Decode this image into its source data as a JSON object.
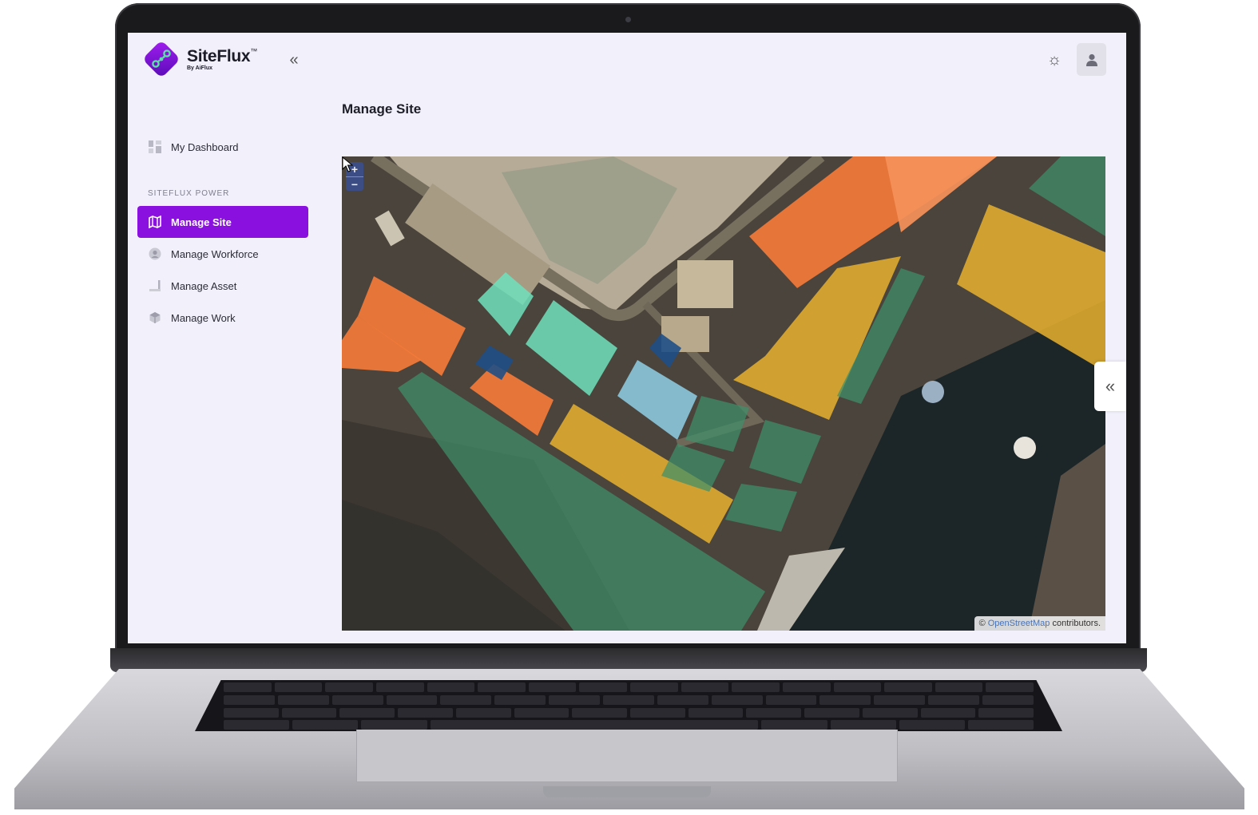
{
  "brand": {
    "name": "SiteFlux",
    "tm": "™",
    "sub": "By AiFlux"
  },
  "sidebar": {
    "collapse_icon": "double-chevron-left-icon",
    "dashboard_label": "My Dashboard",
    "section_label": "SITEFLUX POWER",
    "items": [
      {
        "label": "Manage Site",
        "icon": "map-icon",
        "active": true
      },
      {
        "label": "Manage Workforce",
        "icon": "user-circle-icon",
        "active": false
      },
      {
        "label": "Manage Asset",
        "icon": "crane-icon",
        "active": false
      },
      {
        "label": "Manage Work",
        "icon": "cube-icon",
        "active": false
      }
    ]
  },
  "header": {
    "theme_icon": "sun-icon",
    "avatar_icon": "user-icon"
  },
  "main": {
    "title": "Manage Site",
    "map": {
      "zoom_in": "+",
      "zoom_out": "−",
      "attribution_prefix": "©",
      "attribution_link": "OpenStreetMap",
      "attribution_suffix": "contributors.",
      "panel_toggle": "«"
    }
  },
  "colors": {
    "accent": "#8a10e0",
    "zone_orange": "#f27a3a",
    "zone_yellow": "#e8b22e",
    "zone_green": "#3e8f6a",
    "zone_teal": "#6ee0bc",
    "zone_lightblue": "#8fcfe6",
    "zone_navy": "#1f4f86"
  }
}
